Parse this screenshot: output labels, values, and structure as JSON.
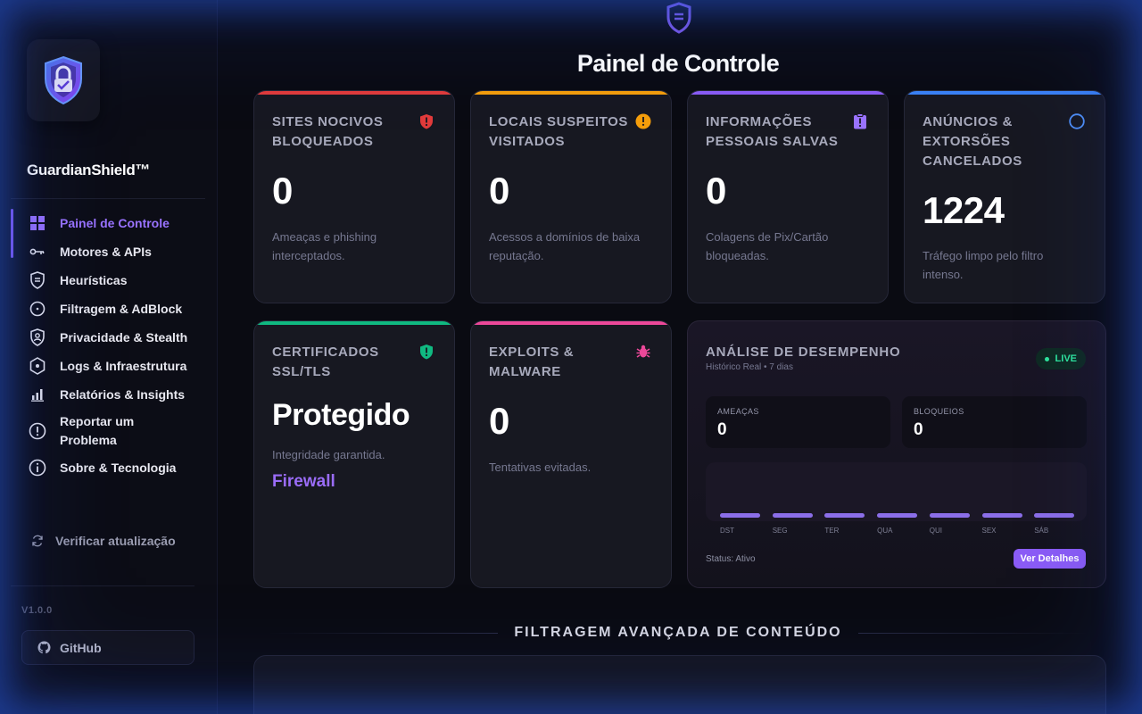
{
  "app": {
    "brand": "GuardianShield™",
    "version": "V1.0.0",
    "accent": "#8b5cf6"
  },
  "sidebar": {
    "items": [
      {
        "label": "Painel de Controle",
        "icon": "grid-icon",
        "active": true
      },
      {
        "label": "Motores & APIs",
        "icon": "key-icon"
      },
      {
        "label": "Heurísticas",
        "icon": "shield-lines-icon"
      },
      {
        "label": "Filtragem & AdBlock",
        "icon": "clock-circle-icon"
      },
      {
        "label": "Privacidade & Stealth",
        "icon": "shield-person-icon"
      },
      {
        "label": "Logs & Infraestrutura",
        "icon": "hexagon-icon"
      },
      {
        "label": "Relatórios & Insights",
        "icon": "bar-chart-icon"
      },
      {
        "label": "Reportar um Problema",
        "icon": "alert-circle-icon"
      },
      {
        "label": "Sobre & Tecnologia",
        "icon": "info-circle-icon"
      }
    ],
    "update_label": "Verificar atualização",
    "github_label": "GitHub"
  },
  "main": {
    "title": "Painel de Controle",
    "cards": [
      {
        "title": "SITES NOCIVOS BLOQUEADOS",
        "value": "0",
        "desc": "Ameaças e phishing interceptados.",
        "color": "#e23b3b",
        "icon": "alert-shield-icon"
      },
      {
        "title": "LOCAIS SUSPEITOS VISITADOS",
        "value": "0",
        "desc": "Acessos a domínios de baixa reputação.",
        "color": "#f59e0b",
        "icon": "warning-circle-icon"
      },
      {
        "title": "INFORMAÇÕES PESSOAIS SALVAS",
        "value": "0",
        "desc": "Colagens de Pix/Cartão bloqueadas.",
        "color": "#8b5cf6",
        "icon": "clipboard-alert-icon"
      },
      {
        "title": "ANÚNCIOS & EXTORSÕES CANCELADOS",
        "value": "1224",
        "desc": "Tráfego limpo pelo filtro intenso.",
        "color": "#3b82f6",
        "icon": "circle-outline-icon"
      },
      {
        "title": "CERTIFICADOS SSL/TLS",
        "value": "Protegido",
        "desc": "Integridade garantida.",
        "extra": "Firewall",
        "color": "#10b981",
        "icon": "shield-check-icon"
      },
      {
        "title": "EXPLOITS & MALWARE",
        "value": "0",
        "desc": "Tentativas evitadas.",
        "color": "#ec4899",
        "icon": "bug-icon"
      }
    ],
    "performance": {
      "title": "ANÁLISE DE DESEMPENHO",
      "subtitle": "Histórico Real • 7 dias",
      "live": "LIVE",
      "threats_label": "AMEAÇAS",
      "threats_value": "0",
      "blocks_label": "BLOQUEIOS",
      "blocks_value": "0",
      "days": [
        "DST",
        "SEG",
        "TER",
        "QUA",
        "QUI",
        "SEX",
        "SÁB"
      ],
      "status": "Status: Ativo",
      "button": "Ver Detalhes"
    },
    "section_title": "FILTRAGEM AVANÇADA DE CONTEÚDO"
  }
}
